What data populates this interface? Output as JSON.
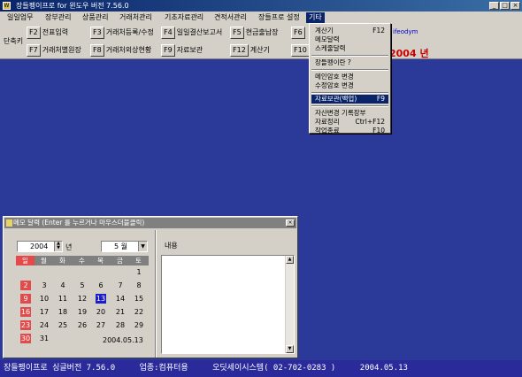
{
  "window": {
    "title": "장들펭이프로 for 윈도우 버전 7.56.0",
    "app_icon": "W"
  },
  "menubar": [
    "일일업무",
    "장부관리",
    "상품관리",
    "거래처관리",
    "기초자료관리",
    "견적서관리",
    "장들프로 설정",
    "기타"
  ],
  "toolbar": {
    "label": "단축키",
    "row1": [
      {
        "key": "F2",
        "label": "전표입력"
      },
      {
        "key": "F3",
        "label": "거래처등록/수정"
      },
      {
        "key": "F4",
        "label": "일일결산보고서"
      },
      {
        "key": "F5",
        "label": "현금출납장"
      },
      {
        "key": "F6",
        "label": ""
      }
    ],
    "row2": [
      {
        "key": "F7",
        "label": "거래처별원장"
      },
      {
        "key": "F8",
        "label": "거래처외상현황"
      },
      {
        "key": "F9",
        "label": "자료보관"
      },
      {
        "key": "F12",
        "label": "계산기"
      },
      {
        "key": "F10",
        "label": ""
      }
    ],
    "user": "ifeodym",
    "year_text": "2004 년"
  },
  "dropdown": [
    {
      "label": "계산기",
      "shortcut": "F12"
    },
    {
      "label": "메모달력",
      "shortcut": ""
    },
    {
      "label": "스케줄달력",
      "shortcut": ""
    },
    {
      "sep": true
    },
    {
      "label": "장들펭이란 ?",
      "shortcut": ""
    },
    {
      "sep": true
    },
    {
      "label": "메인암호 변경",
      "shortcut": ""
    },
    {
      "label": "수정암호 변경",
      "shortcut": ""
    },
    {
      "sep": true
    },
    {
      "label": "자료보관(백업)",
      "shortcut": "F9",
      "highlight": true
    },
    {
      "sep": true
    },
    {
      "label": "자산변경 기록장부",
      "shortcut": ""
    },
    {
      "label": "자료정리",
      "shortcut": "Ctrl+F12"
    },
    {
      "label": "작업종료",
      "shortcut": "F10"
    }
  ],
  "memo": {
    "title": "메모 달력 (Enter 를 누르거나 마우스더블클릭)",
    "year": "2004",
    "year_label": "년",
    "month": "5 월",
    "weekdays": [
      "일",
      "월",
      "화",
      "수",
      "목",
      "금",
      "토"
    ],
    "weeks": [
      [
        "",
        "",
        "",
        "",
        "",
        "",
        "1"
      ],
      [
        "2",
        "3",
        "4",
        "5",
        "6",
        "7",
        "8"
      ],
      [
        "9",
        "10",
        "11",
        "12",
        "13",
        "14",
        "15"
      ],
      [
        "16",
        "17",
        "18",
        "19",
        "20",
        "21",
        "22"
      ],
      [
        "23",
        "24",
        "25",
        "26",
        "27",
        "28",
        "29"
      ],
      [
        "30",
        "31",
        "",
        "",
        "",
        "",
        ""
      ]
    ],
    "today": "13",
    "date_text": "2004.05.13",
    "content_label": "내용",
    "content_text": ""
  },
  "statusbar": [
    "장들펭이프로 싱글버전 7.56.0",
    "업종:컴퓨터용",
    "오딧세이시스템( 02-702-0283 )",
    "2004.05.13"
  ],
  "colors": {
    "desktop": "#2b3a99",
    "menu_highlight": "#0a246a",
    "sunday": "#e34b4b",
    "today": "#1c1cc8",
    "status": "#2a2a9a"
  }
}
